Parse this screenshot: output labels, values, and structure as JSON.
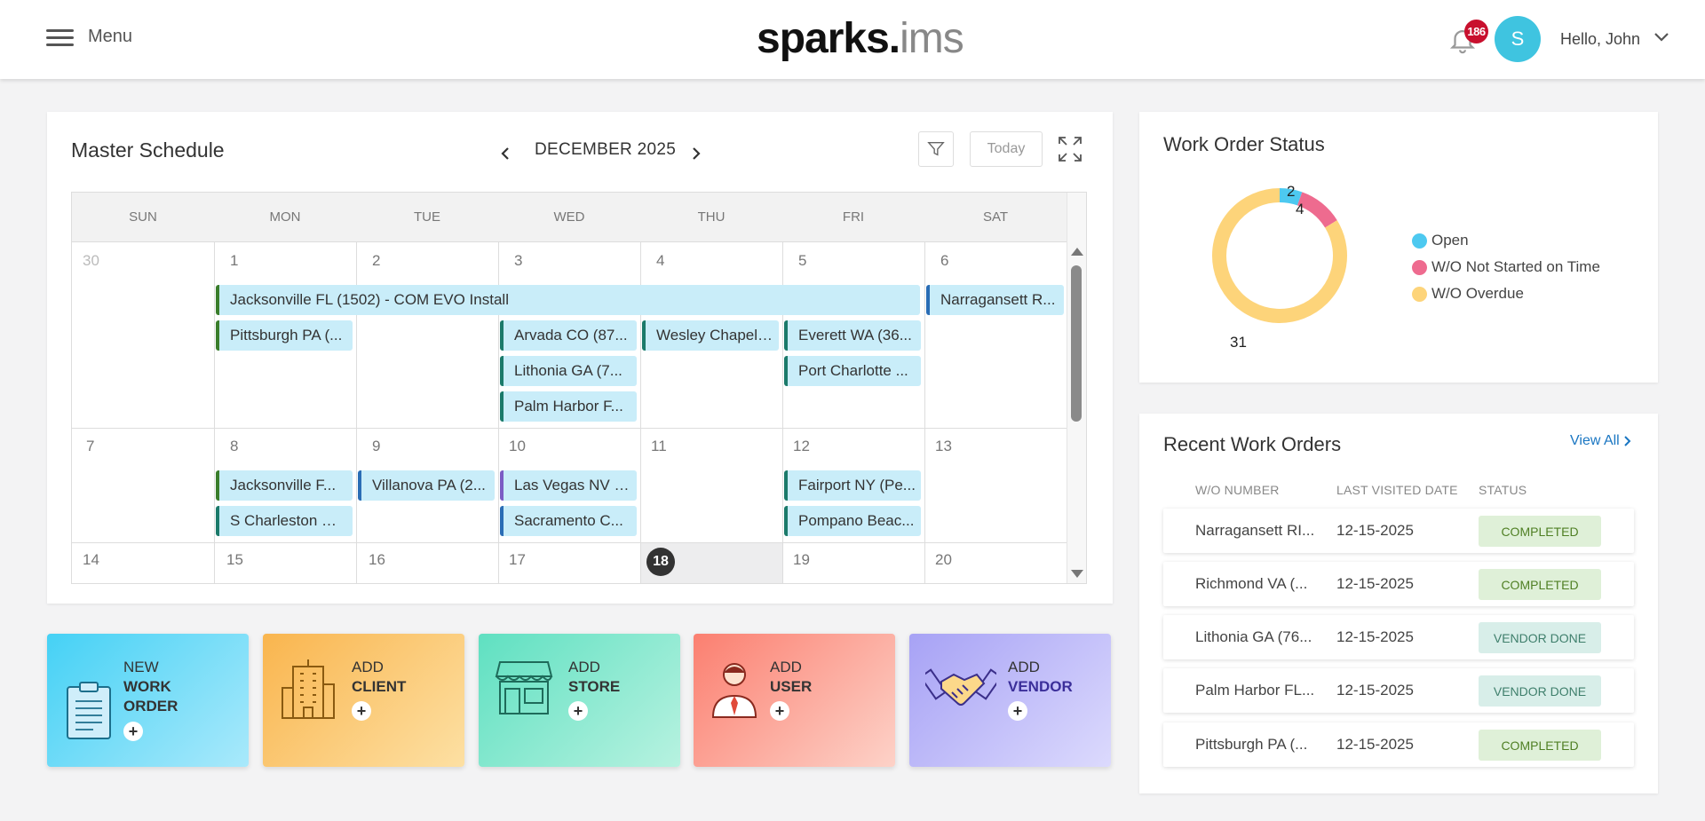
{
  "header": {
    "menu_label": "Menu",
    "logo_bold": "sparks.",
    "logo_light": "ims",
    "notifications_count": "186",
    "avatar_initial": "S",
    "greeting": "Hello, John"
  },
  "schedule": {
    "title": "Master Schedule",
    "month": "DECEMBER 2025",
    "today_label": "Today",
    "weekdays": [
      "SUN",
      "MON",
      "TUE",
      "WED",
      "THU",
      "FRI",
      "SAT"
    ],
    "weeks": [
      [
        "30",
        "1",
        "2",
        "3",
        "4",
        "5",
        "6"
      ],
      [
        "7",
        "8",
        "9",
        "10",
        "11",
        "12",
        "13"
      ],
      [
        "14",
        "15",
        "16",
        "17",
        "18",
        "19",
        "20"
      ]
    ],
    "events": {
      "e1": "Jacksonville FL (1502) - COM EVO Install",
      "e2": "Narragansett R...",
      "e3": "Pittsburgh PA (...",
      "e4": "Arvada CO (87...",
      "e5": "Wesley Chapel ...",
      "e6": "Everett WA (36...",
      "e7": "Lithonia GA (7...",
      "e8": "Port Charlotte ...",
      "e9": "Palm Harbor F...",
      "e10": "Jacksonville F...",
      "e11": "Villanova PA (2...",
      "e12": "Las Vegas NV (...",
      "e13": "Fairport NY (Pe...",
      "e14": "S Charleston W...",
      "e15": "Sacramento C...",
      "e16": "Pompano Beac..."
    },
    "event_colors": {
      "green": "#3a7d2b",
      "teal": "#1b7a6a",
      "blue": "#2a6db5",
      "purple": "#7b5cc4",
      "fill": "#c9edf9"
    }
  },
  "tiles": [
    {
      "line1": "NEW",
      "line2": "WORK",
      "line3": "ORDER",
      "icon": "clipboard-icon",
      "gradient": [
        "#45d1f5",
        "#a9e9fb"
      ]
    },
    {
      "line1": "ADD",
      "line2": "CLIENT",
      "icon": "building-icon",
      "gradient": [
        "#f9b54e",
        "#fde0a3"
      ]
    },
    {
      "line1": "ADD",
      "line2": "STORE",
      "icon": "store-icon",
      "gradient": [
        "#5fe0c1",
        "#b7f2e0"
      ]
    },
    {
      "line1": "ADD",
      "line2": "USER",
      "icon": "user-icon",
      "gradient": [
        "#fb7f70",
        "#fdd2c8"
      ]
    },
    {
      "line1": "ADD",
      "line2": "VENDOR",
      "icon": "handshake-icon",
      "gradient": [
        "#a7a2f5",
        "#dcdafd"
      ]
    }
  ],
  "work_order_status": {
    "title": "Work Order Status",
    "chart_data": {
      "type": "pie",
      "categories": [
        "Open",
        "W/O Not Started on Time",
        "W/O Overdue"
      ],
      "values": [
        2,
        4,
        31
      ],
      "colors": [
        "#4dc9f0",
        "#ee6b8f",
        "#fdd47a"
      ],
      "donut": true
    }
  },
  "recent_work_orders": {
    "title": "Recent Work Orders",
    "view_all": "View All",
    "columns": [
      "W/O NUMBER",
      "LAST VISITED DATE",
      "STATUS"
    ],
    "rows": [
      {
        "number": "Narragansett RI...",
        "date": "12-15-2025",
        "status": "COMPLETED"
      },
      {
        "number": "Richmond VA (...",
        "date": "12-15-2025",
        "status": "COMPLETED"
      },
      {
        "number": "Lithonia GA (76...",
        "date": "12-15-2025",
        "status": "VENDOR DONE"
      },
      {
        "number": "Palm Harbor FL...",
        "date": "12-15-2025",
        "status": "VENDOR DONE"
      },
      {
        "number": "Pittsburgh PA (...",
        "date": "12-15-2025",
        "status": "COMPLETED"
      }
    ]
  }
}
